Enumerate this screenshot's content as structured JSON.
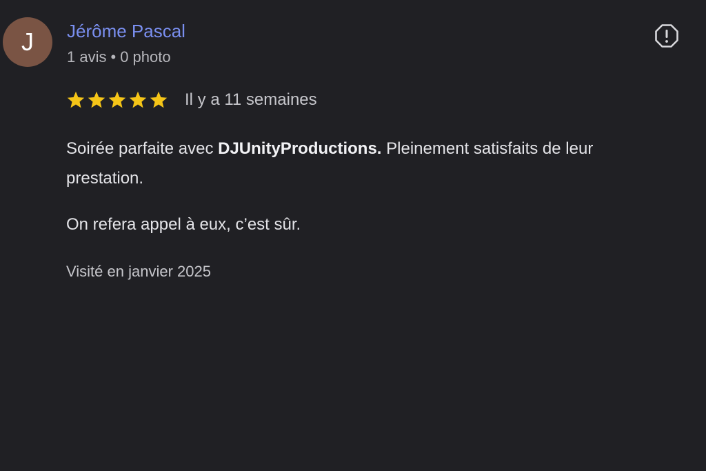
{
  "author": {
    "initial": "J",
    "name": "Jérôme Pascal",
    "reviews_count": "1 avis",
    "separator": "•",
    "photos_count": "0 photo",
    "avatar_color": "#7a5444",
    "name_color": "#7a8ff0"
  },
  "report": {
    "icon": "report-octagon-icon"
  },
  "rating": {
    "stars": 5,
    "max_stars": 5,
    "star_color": "#f5c518",
    "date": "Il y a 11 semaines"
  },
  "review": {
    "line1_before": "Soirée parfaite avec ",
    "brand": "DJUnityProductions.",
    "line1_after": " Pleinement satisfaits de leur prestation.",
    "line2": "On refera appel à eux, c’est sûr.",
    "visit": "Visité en janvier 2025"
  }
}
